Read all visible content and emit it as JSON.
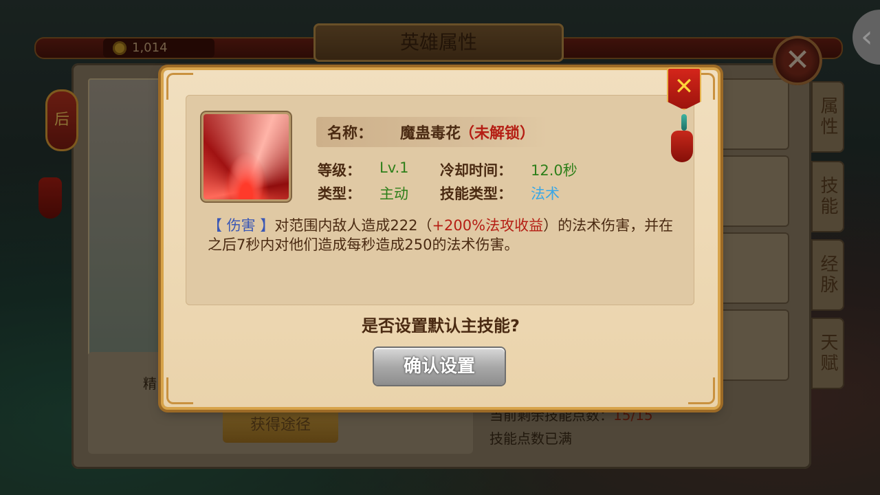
{
  "header": {
    "title": "英雄属性",
    "coins": "1,014"
  },
  "side_tabs": [
    "属性",
    "技能",
    "经脉",
    "天赋"
  ],
  "background": {
    "left_label_fragment": "精",
    "get_route_button": "获得途径",
    "skill_points_full": "技能点数已满",
    "skill_points_remaining": "当前剩余技能点数：",
    "skill_points_value": "15/15"
  },
  "modal": {
    "name_label": "名称：",
    "name_value": "魔蛊毒花",
    "lock_status": "（未解锁）",
    "level_label": "等级：",
    "level_value": "Lv.1",
    "cooldown_label": "冷却时间：",
    "cooldown_value": "12.0秒",
    "type_label": "类型：",
    "type_value": "主动",
    "skill_type_label": "技能类型：",
    "skill_type_value": "法术",
    "desc_tag": "【 伤害 】",
    "desc_part1": "对范围内敌人造成222（",
    "desc_bonus": "+200%法攻收益",
    "desc_part2": "）的法术伤害，并在之后7秒内对他们造成每秒造成250的法术伤害。",
    "question": "是否设置默认主技能?",
    "confirm_button": "确认设置"
  },
  "icons": {
    "close_modal": "close-icon",
    "close_main": "close-icon",
    "back": "chevron-left-icon",
    "coin": "coin-icon",
    "skill": "skill-icon"
  },
  "colors": {
    "lock_red": "#b51e14",
    "value_green": "#2e7f1a",
    "value_blue": "#3aa7e6",
    "tag_blue": "#3a57b5",
    "modal_bg": "#f1dfbf",
    "gold_frame": "#d7a34a"
  }
}
